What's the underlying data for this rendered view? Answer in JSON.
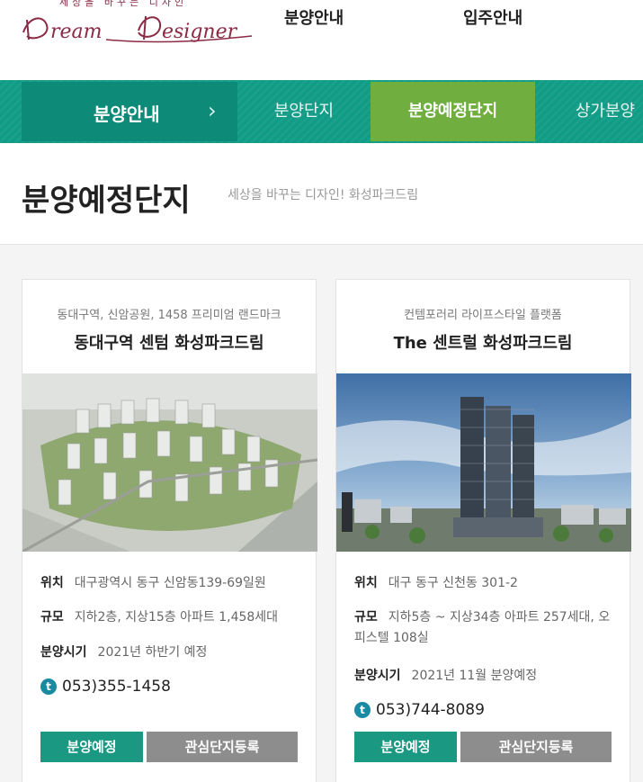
{
  "logo": {
    "tagline": "세상을 바꾸는 디자인",
    "script": "Dream Designer"
  },
  "topnav": {
    "item1": "분양안내",
    "item2": "입주안내"
  },
  "subnav": {
    "current": "분양안내",
    "items": [
      "분양단지",
      "분양예정단지",
      "상가분양"
    ]
  },
  "page": {
    "title": "분양예정단지",
    "subtitle": "세상을 바꾸는 디자인! 화성파크드림"
  },
  "cards": [
    {
      "tag": "동대구역, 신암공원, 1458 프리미엄 랜드마크",
      "name": "동대구역 센텀 화성파크드림",
      "location_label": "위치",
      "location": "대구광역시 동구 신암동139-69일원",
      "scale_label": "규모",
      "scale": "지하2층, 지상15층 아파트 1,458세대",
      "period_label": "분양시기",
      "period": "2021년 하반기 예정",
      "phone_icon": "t",
      "phone": "053)355-1458",
      "btn_status": "분양예정",
      "btn_register": "관심단지등록"
    },
    {
      "tag": "컨템포러리 라이프스타일 플랫폼",
      "name": "The 센트럴 화성파크드림",
      "location_label": "위치",
      "location": "대구 동구 신천동 301-2",
      "scale_label": "규모",
      "scale": "지하5층 ~ 지상34층 아파트 257세대, 오피스텔 108실",
      "period_label": "분양시기",
      "period": "2021년 11월 분양예정",
      "phone_icon": "t",
      "phone": "053)744-8089",
      "btn_status": "분양예정",
      "btn_register": "관심단지등록"
    }
  ],
  "colors": {
    "green": "#119c86",
    "active": "#6fae3f",
    "brand": "#8a2a45"
  }
}
